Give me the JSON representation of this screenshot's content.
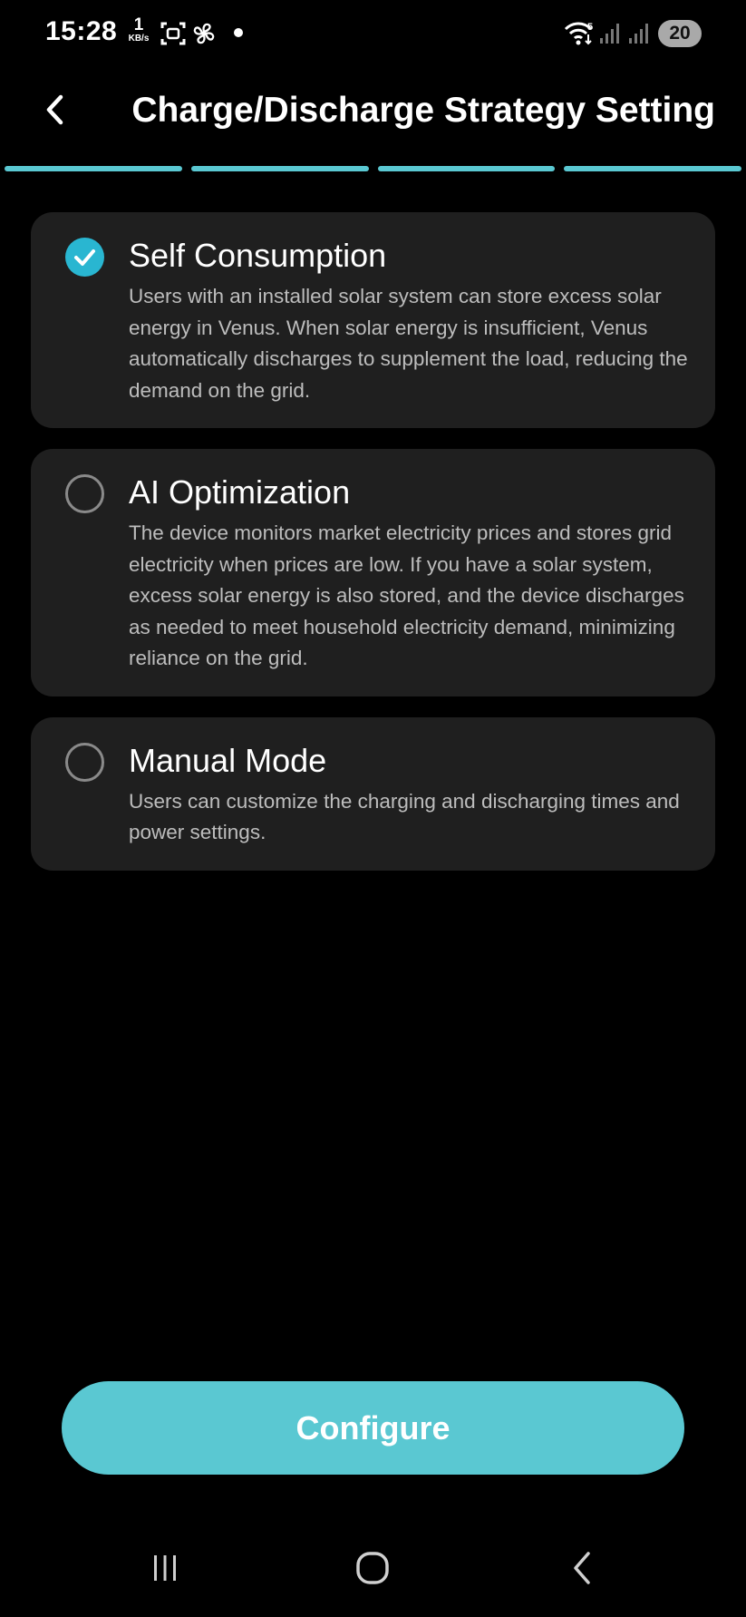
{
  "status_bar": {
    "time": "15:28",
    "net_speed_value": "1",
    "net_speed_unit": "KB/s",
    "wifi_label": "5",
    "battery": "20",
    "icons": [
      "screenshot-icon",
      "fan-icon",
      "notification-dot-icon",
      "wifi-icon",
      "signal-icon",
      "signal-icon"
    ]
  },
  "header": {
    "title": "Charge/Discharge Strategy Setting",
    "back_icon": "chevron-left-icon"
  },
  "progress": {
    "total_steps": 4,
    "completed_steps": 4,
    "color": "#5ac8d2"
  },
  "options": [
    {
      "title": "Self Consumption",
      "description": "Users with an installed solar system can store excess solar energy in Venus. When solar energy is insufficient, Venus automatically discharges to supplement the load, reducing the demand on the grid.",
      "selected": true
    },
    {
      "title": "AI Optimization",
      "description": "The device monitors market electricity prices and stores grid electricity when prices are low. If you have a solar system, excess solar energy is also stored, and the device discharges as needed to meet household electricity demand, minimizing reliance on the grid.",
      "selected": false
    },
    {
      "title": "Manual Mode",
      "description": "Users can customize the charging and discharging times and power settings.",
      "selected": false
    }
  ],
  "configure_button": {
    "label": "Configure"
  },
  "nav_bar": {
    "icons": [
      "recent-apps-icon",
      "home-icon",
      "back-icon"
    ]
  },
  "colors": {
    "accent": "#5ac8d2",
    "check": "#29b6d1",
    "background": "#000000",
    "card": "#1f1f1f",
    "text_secondary": "#bdbdbd"
  }
}
